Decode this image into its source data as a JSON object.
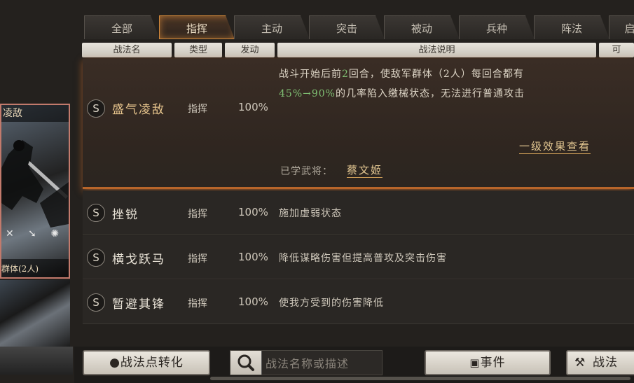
{
  "tabs": [
    {
      "label": "全部"
    },
    {
      "label": "指挥"
    },
    {
      "label": "主动"
    },
    {
      "label": "突击"
    },
    {
      "label": "被动"
    },
    {
      "label": "兵种"
    },
    {
      "label": "阵法"
    },
    {
      "label": "启"
    }
  ],
  "columns": {
    "name": "战法名",
    "type": "类型",
    "trigger": "发动",
    "desc": "战法说明",
    "extra": "可"
  },
  "card": {
    "title": "凌敌",
    "target": "群体(2人)",
    "icons": "✕ ➘ ✺"
  },
  "selected": {
    "icon": "S",
    "name": "盛气凌敌",
    "type": "指挥",
    "rate": "100%",
    "desc_a": "战斗开始后前",
    "desc_num": "2",
    "desc_b": "回合，使敌军群体（2人）每回合都有",
    "desc_range": "45%→90%",
    "desc_c": "的几率陷入缴械状态，无法进行普通攻击",
    "level_link": "一级效果查看",
    "learned_label": "已学武将：",
    "learned_general": "蔡文姬"
  },
  "rows": [
    {
      "icon": "S",
      "name": "挫锐",
      "type": "指挥",
      "rate": "100%",
      "desc": "施加虚弱状态"
    },
    {
      "icon": "S",
      "name": "横戈跃马",
      "type": "指挥",
      "rate": "100%",
      "desc": "降低谋略伤害但提高普攻及突击伤害"
    },
    {
      "icon": "S",
      "name": "暂避其锋",
      "type": "指挥",
      "rate": "100%",
      "desc": "使我方受到的伤害降低"
    }
  ],
  "bottom": {
    "convert_label": "战法点转化",
    "search_placeholder": "战法名称或描述",
    "event_label": "事件",
    "right_label": "战法"
  },
  "colors": {
    "accent": "#d0883c",
    "green_text": "#7fbf73",
    "gold_text": "#e7c58d"
  }
}
